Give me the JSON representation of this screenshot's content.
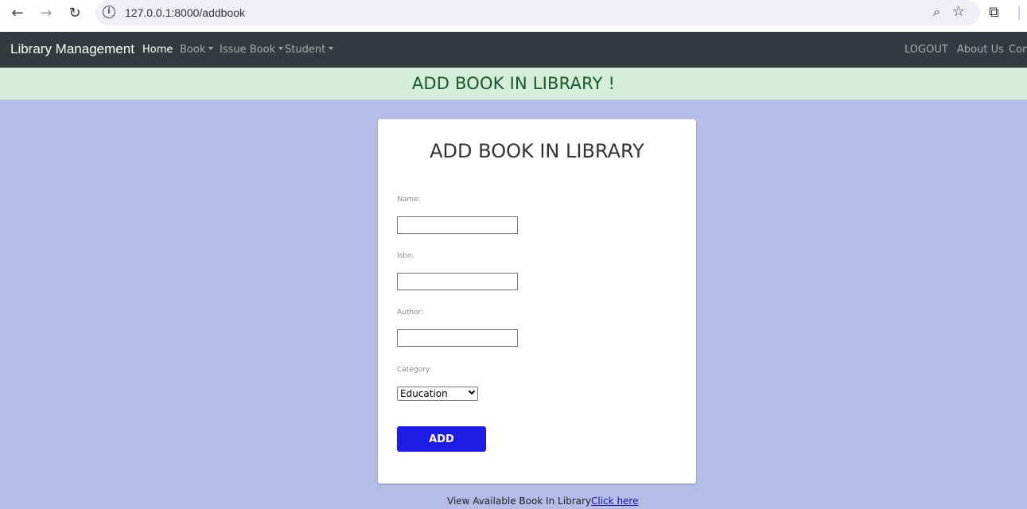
{
  "browser": {
    "url": "127.0.0.1:8000/addbook",
    "back_icon": "←",
    "forward_icon": "→",
    "reload_icon": "↻",
    "info_icon": "i",
    "zoom_icon": "⌕",
    "star_icon": "☆",
    "extensions_icon": "⧉"
  },
  "navbar": {
    "brand": "Library Management",
    "links": [
      {
        "label": "Home"
      },
      {
        "label": "Book"
      },
      {
        "label": "Issue Book"
      },
      {
        "label": "Student"
      }
    ],
    "right_links": [
      {
        "label": "LOGOUT"
      },
      {
        "label": "About Us"
      },
      {
        "label": "Con"
      }
    ]
  },
  "banner": {
    "text": "ADD BOOK IN LIBRARY !"
  },
  "form": {
    "title": "ADD BOOK IN LIBRARY",
    "fields": [
      {
        "label": "Name:",
        "value": ""
      },
      {
        "label": "Isbn:",
        "value": ""
      },
      {
        "label": "Author:",
        "value": ""
      }
    ],
    "category_label": "Category:",
    "category_value": "Education",
    "submit_label": "ADD"
  },
  "footer": {
    "text": "View Available Book In Library",
    "link_label": "Click here"
  },
  "colors": {
    "page_bg": "#b5bce8",
    "navbar_bg": "#343a40",
    "banner_bg": "#d4eddb",
    "banner_text": "#18582a",
    "button_bg": "#1c1ce6"
  }
}
